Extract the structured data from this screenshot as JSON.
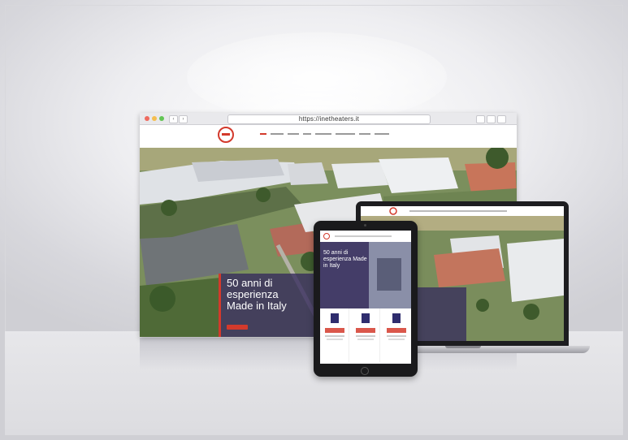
{
  "browser": {
    "url": "https://inetheaters.it",
    "menu_items": [
      "",
      "",
      "",
      "",
      "",
      "",
      "",
      ""
    ]
  },
  "hero": {
    "title_line1": "50 anni di",
    "title_line2": "esperienza",
    "title_line3": "Made in Italy"
  },
  "tablet": {
    "title": "50 anni di esperienza Made in Italy"
  },
  "colors": {
    "brand_red": "#d33a2c",
    "overlay_purple": "#342a5c",
    "icon_navy": "#2f2d6e"
  }
}
